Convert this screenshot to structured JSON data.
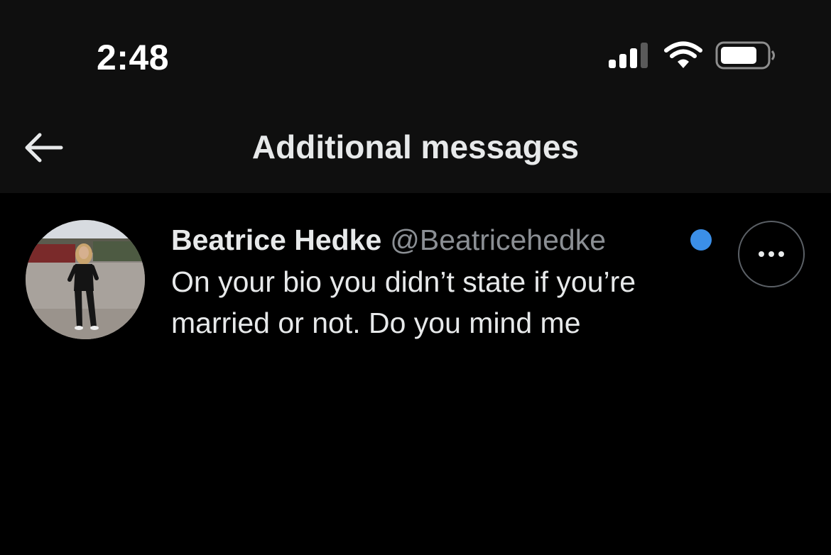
{
  "status_bar": {
    "time": "2:48",
    "icons": [
      "cellular-signal-icon",
      "wifi-icon",
      "battery-icon"
    ]
  },
  "header": {
    "title": "Additional messages",
    "back_icon": "arrow-left-icon"
  },
  "messages": [
    {
      "display_name": "Beatrice Hedke",
      "handle": "@Beatricehedke",
      "preview": "On your bio you didn’t state if you’re married or not. Do you mind me",
      "unread": true,
      "more_icon": "ellipsis-icon"
    }
  ],
  "colors": {
    "background": "#000000",
    "header_background": "#0f0f0f",
    "text_primary": "#e7e9ea",
    "text_secondary": "#8b8f94",
    "unread_dot": "#3b8fe8"
  }
}
